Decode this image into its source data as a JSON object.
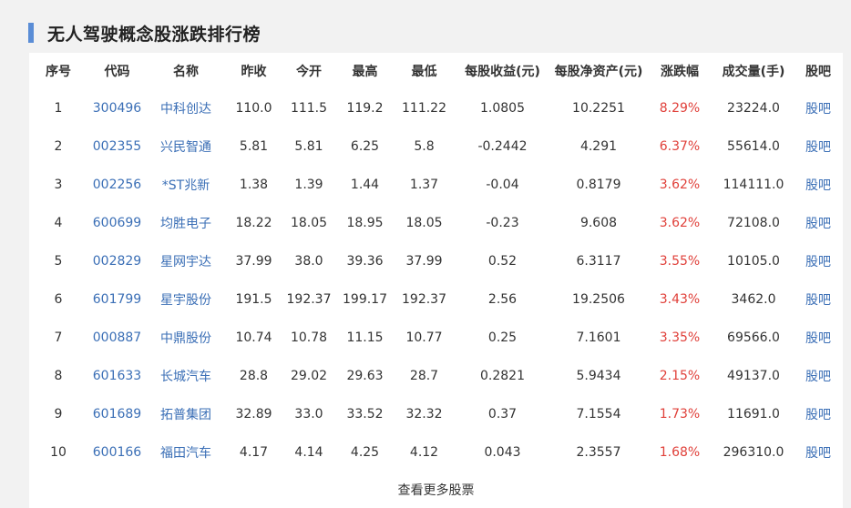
{
  "title": "无人驾驶概念股涨跌排行榜",
  "columns": [
    "序号",
    "代码",
    "名称",
    "昨收",
    "今开",
    "最高",
    "最低",
    "每股收益(元)",
    "每股净资产(元)",
    "涨跌幅",
    "成交量(手)",
    "股吧"
  ],
  "rows": [
    [
      "1",
      "300496",
      "中科创达",
      "110.0",
      "111.5",
      "119.2",
      "111.22",
      "1.0805",
      "10.2251",
      "8.29%",
      "23224.0",
      "股吧"
    ],
    [
      "2",
      "002355",
      "兴民智通",
      "5.81",
      "5.81",
      "6.25",
      "5.8",
      "-0.2442",
      "4.291",
      "6.37%",
      "55614.0",
      "股吧"
    ],
    [
      "3",
      "002256",
      "*ST兆新",
      "1.38",
      "1.39",
      "1.44",
      "1.37",
      "-0.04",
      "0.8179",
      "3.62%",
      "114111.0",
      "股吧"
    ],
    [
      "4",
      "600699",
      "均胜电子",
      "18.22",
      "18.05",
      "18.95",
      "18.05",
      "-0.23",
      "9.608",
      "3.62%",
      "72108.0",
      "股吧"
    ],
    [
      "5",
      "002829",
      "星网宇达",
      "37.99",
      "38.0",
      "39.36",
      "37.99",
      "0.52",
      "6.3117",
      "3.55%",
      "10105.0",
      "股吧"
    ],
    [
      "6",
      "601799",
      "星宇股份",
      "191.5",
      "192.37",
      "199.17",
      "192.37",
      "2.56",
      "19.2506",
      "3.43%",
      "3462.0",
      "股吧"
    ],
    [
      "7",
      "000887",
      "中鼎股份",
      "10.74",
      "10.78",
      "11.15",
      "10.77",
      "0.25",
      "7.1601",
      "3.35%",
      "69566.0",
      "股吧"
    ],
    [
      "8",
      "601633",
      "长城汽车",
      "28.8",
      "29.02",
      "29.63",
      "28.7",
      "0.2821",
      "5.9434",
      "2.15%",
      "49137.0",
      "股吧"
    ],
    [
      "9",
      "601689",
      "拓普集团",
      "32.89",
      "33.0",
      "33.52",
      "32.32",
      "0.37",
      "7.1554",
      "1.73%",
      "11691.0",
      "股吧"
    ],
    [
      "10",
      "600166",
      "福田汽车",
      "4.17",
      "4.14",
      "4.25",
      "4.12",
      "0.043",
      "2.3557",
      "1.68%",
      "296310.0",
      "股吧"
    ]
  ],
  "more_label": "查看更多股票",
  "colors": {
    "accent": "#5a8dd6",
    "link": "#3b6fb6",
    "up": "#e0403a"
  }
}
